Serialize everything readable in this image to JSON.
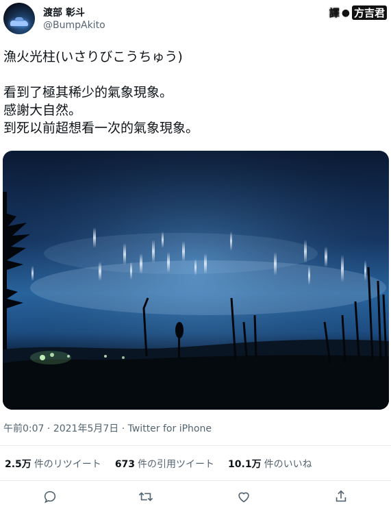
{
  "user": {
    "display_name": "渡部 彰斗",
    "handle": "@BumpAkito",
    "avatar_icon": "avatar-photo"
  },
  "translator_badge": {
    "label_left": "譯",
    "label_right": "方吉君"
  },
  "tweet": {
    "title_line": "漁火光柱(いさりびこうちゅう)",
    "lines": [
      "看到了極其稀少的氣象現象。",
      "感謝大自然。",
      "到死以前超想看一次的氣象現象。"
    ]
  },
  "photo": {
    "icon": "night-sky-light-pillars-photo"
  },
  "meta": {
    "time": "午前0:07",
    "sep1": " · ",
    "date": "2021年5月7日",
    "sep2": " · ",
    "source": "Twitter for iPhone"
  },
  "stats": [
    {
      "value": "2.5万",
      "label": "件のリツイート"
    },
    {
      "value": "673",
      "label": "件の引用ツイート"
    },
    {
      "value": "10.1万",
      "label": "件のいいね"
    }
  ],
  "actions": [
    {
      "icon": "reply-icon"
    },
    {
      "icon": "retweet-icon"
    },
    {
      "icon": "like-icon"
    },
    {
      "icon": "share-icon"
    }
  ],
  "colors": {
    "text": "#0f1419",
    "muted": "#536471",
    "divider": "#e6ecf0"
  }
}
